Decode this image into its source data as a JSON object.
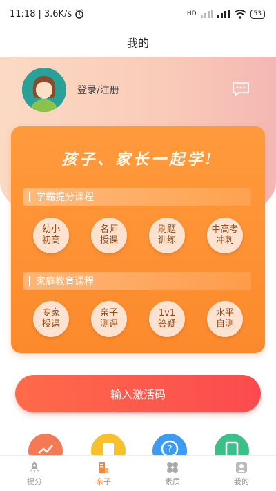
{
  "status": {
    "time": "11:18",
    "speed": "3.6K/s",
    "battery": "53",
    "hd": "HD"
  },
  "header": {
    "title": "我的"
  },
  "profile": {
    "login_label": "登录/注册"
  },
  "card": {
    "slogan": "孩子、家长一起学!",
    "sections": [
      {
        "title": "学霸提分课程",
        "items": [
          {
            "line1": "幼小",
            "line2": "初高"
          },
          {
            "line1": "名师",
            "line2": "授课"
          },
          {
            "line1": "刷题",
            "line2": "训练"
          },
          {
            "line1": "中高考",
            "line2": "冲刺"
          }
        ]
      },
      {
        "title": "家庭教育课程",
        "items": [
          {
            "line1": "专家",
            "line2": "授课"
          },
          {
            "line1": "亲子",
            "line2": "测评"
          },
          {
            "line1": "1v1",
            "line2": "答疑"
          },
          {
            "line1": "水平",
            "line2": "自测"
          }
        ]
      }
    ]
  },
  "activate_button": "输入激活码",
  "tabs": [
    {
      "label": "提分",
      "icon": "rocket-icon"
    },
    {
      "label": "亲子",
      "icon": "book-icon"
    },
    {
      "label": "素质",
      "icon": "clover-icon"
    },
    {
      "label": "我的",
      "icon": "person-icon"
    }
  ],
  "active_tab": "亲子",
  "colors": {
    "accent": "#f08a3c",
    "card": "#ff9a3c",
    "button": "#fb4a4f"
  }
}
